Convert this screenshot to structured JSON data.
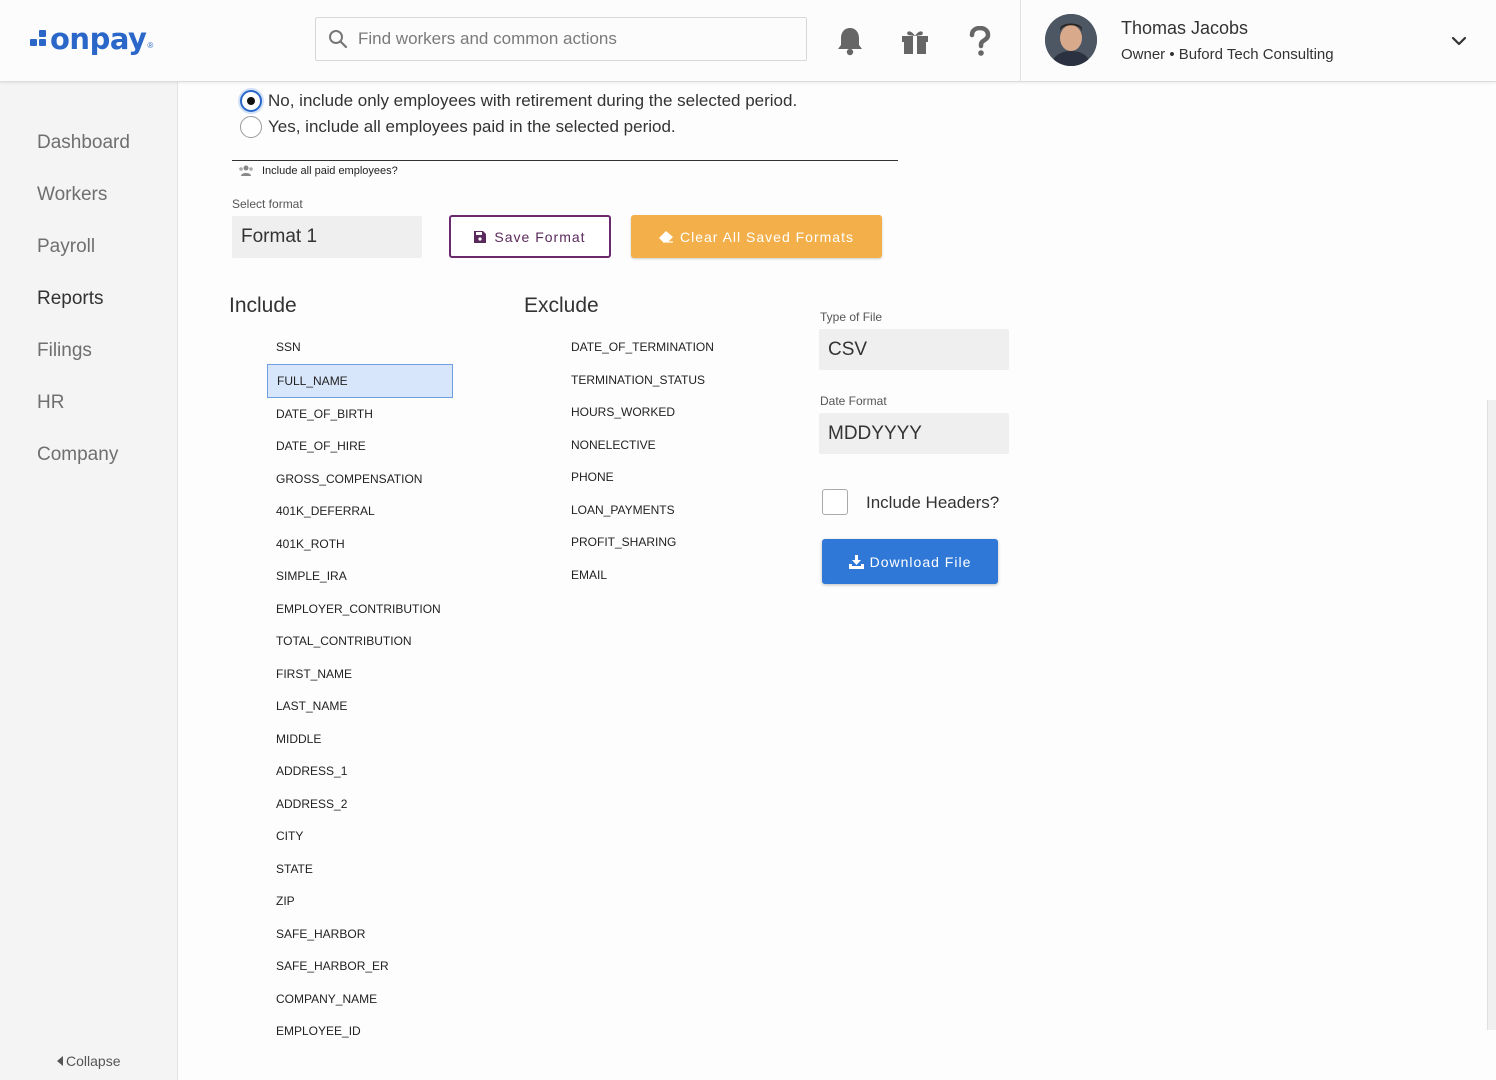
{
  "header": {
    "logo_text": "onpay",
    "logo_reg": "®",
    "search_placeholder": "Find workers and common actions",
    "user": {
      "name": "Thomas Jacobs",
      "subtitle": "Owner • Buford Tech Consulting"
    },
    "icons": [
      "bell-icon",
      "gift-icon",
      "help-icon",
      "chevron-down-icon"
    ]
  },
  "sidebar": {
    "items": [
      {
        "label": "Dashboard",
        "active": false
      },
      {
        "label": "Workers",
        "active": false
      },
      {
        "label": "Payroll",
        "active": false
      },
      {
        "label": "Reports",
        "active": true
      },
      {
        "label": "Filings",
        "active": false
      },
      {
        "label": "HR",
        "active": false
      },
      {
        "label": "Company",
        "active": false
      }
    ],
    "collapse_label": "Collapse"
  },
  "main": {
    "radio_options": [
      {
        "label": "No, include only employees with retirement during the selected period.",
        "checked": true
      },
      {
        "label": "Yes, include all employees paid in the selected period.",
        "checked": false
      }
    ],
    "legend": "Include all paid employees?",
    "select_format_label": "Select format",
    "select_format_value": "Format 1",
    "save_button": "Save Format",
    "clear_button": "Clear All Saved Formats",
    "include_title": "Include",
    "exclude_title": "Exclude",
    "include_items": [
      "SSN",
      "FULL_NAME",
      "DATE_OF_BIRTH",
      "DATE_OF_HIRE",
      "GROSS_COMPENSATION",
      "401K_DEFERRAL",
      "401K_ROTH",
      "SIMPLE_IRA",
      "EMPLOYER_CONTRIBUTION",
      "TOTAL_CONTRIBUTION",
      "FIRST_NAME",
      "LAST_NAME",
      "MIDDLE",
      "ADDRESS_1",
      "ADDRESS_2",
      "CITY",
      "STATE",
      "ZIP",
      "SAFE_HARBOR",
      "SAFE_HARBOR_ER",
      "COMPANY_NAME",
      "EMPLOYEE_ID"
    ],
    "include_selected": "FULL_NAME",
    "exclude_items": [
      "DATE_OF_TERMINATION",
      "TERMINATION_STATUS",
      "HOURS_WORKED",
      "NONELECTIVE",
      "PHONE",
      "LOAN_PAYMENTS",
      "PROFIT_SHARING",
      "EMAIL"
    ],
    "file_type_label": "Type of File",
    "file_type_value": "CSV",
    "date_format_label": "Date Format",
    "date_format_value": "MDDYYYY",
    "include_headers_label": "Include Headers?",
    "include_headers_checked": false,
    "download_button": "Download File"
  },
  "colors": {
    "brand": "#2a67c9",
    "save_border": "#6c2a6e",
    "clear_bg": "#f3b04a",
    "download_bg": "#2f78d8",
    "selected_bg": "#d8e6fb"
  }
}
